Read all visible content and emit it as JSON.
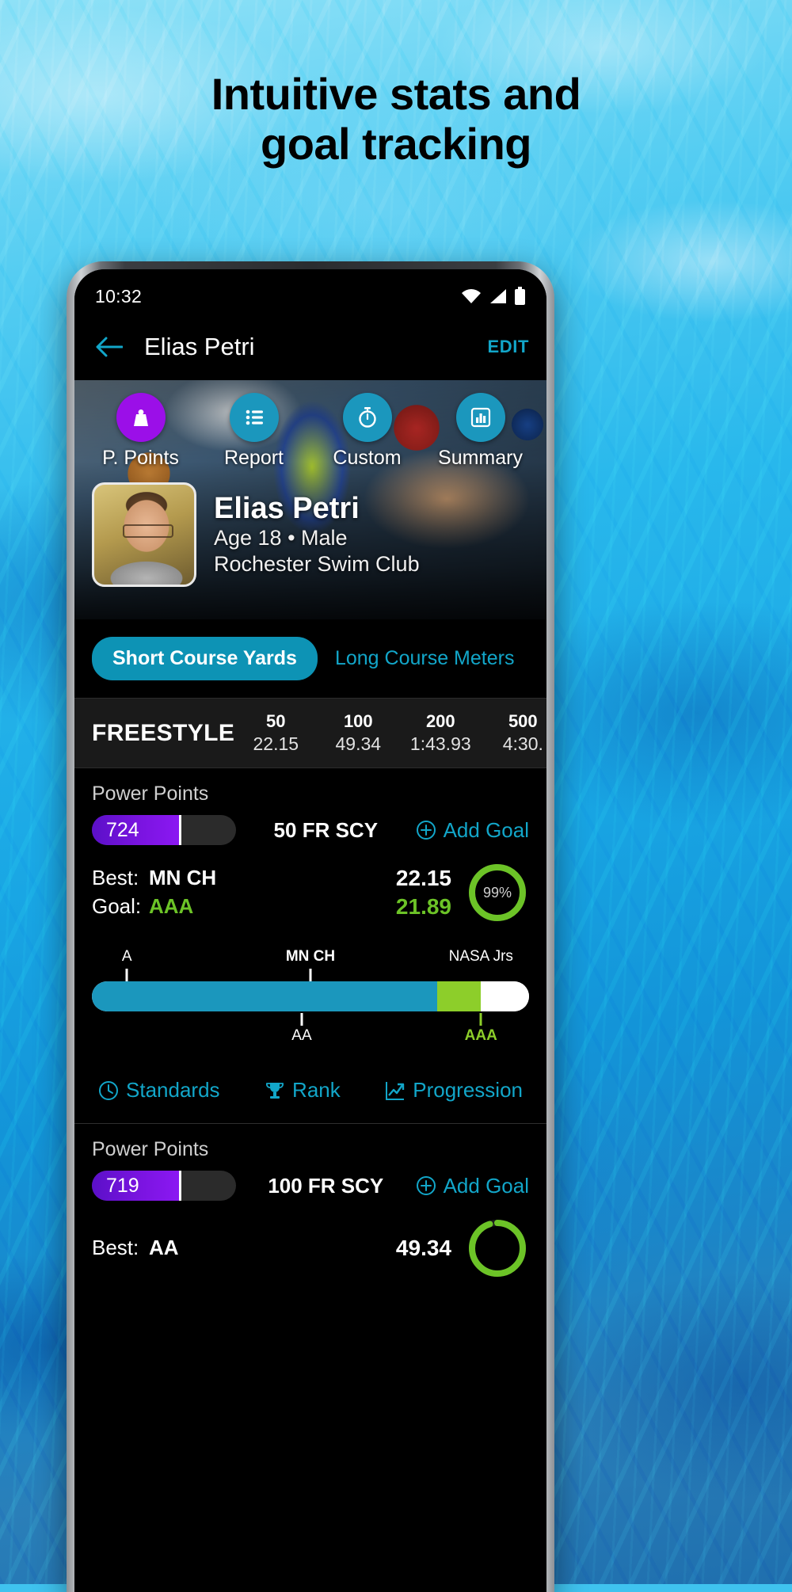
{
  "headline": {
    "line1": "Intuitive stats and",
    "line2": "goal tracking"
  },
  "status_bar": {
    "time": "10:32",
    "icons": [
      "wifi-icon",
      "signal-icon",
      "battery-icon"
    ]
  },
  "app_bar": {
    "back_icon": "back-arrow-icon",
    "title": "Elias Petri",
    "edit_label": "EDIT"
  },
  "quick_actions": [
    {
      "label": "P. Points",
      "icon": "weight-icon",
      "color": "#9b0fe8"
    },
    {
      "label": "Report",
      "icon": "list-icon",
      "color": "#1b97bd"
    },
    {
      "label": "Custom",
      "icon": "stopwatch-icon",
      "color": "#1b97bd"
    },
    {
      "label": "Summary",
      "icon": "bar-chart-icon",
      "color": "#1b97bd"
    }
  ],
  "profile": {
    "name": "Elias Petri",
    "meta_line1": "Age 18 • Male",
    "meta_line2": "Rochester Swim Club",
    "avatar": "profile-photo"
  },
  "course_toggle": {
    "selected": "Short Course Yards",
    "other": "Long Course Meters"
  },
  "stroke_table": {
    "stroke": "FREESTYLE",
    "columns": [
      "50",
      "100",
      "200",
      "500"
    ],
    "times": [
      "22.15",
      "49.34",
      "1:43.93",
      "4:30."
    ]
  },
  "events": [
    {
      "power_points_label": "Power Points",
      "power_points_value": "724",
      "power_points_pct": 62,
      "event": "50 FR SCY",
      "add_goal_label": "Add Goal",
      "add_goal_icon": "plus-circle-icon",
      "best_key": "Best:",
      "best_value": "MN CH",
      "best_time": "22.15",
      "goal_key": "Goal:",
      "goal_value": "AAA",
      "goal_time": "21.89",
      "ring_pct": "99%",
      "ring_value": 99,
      "standards": {
        "top_labels": [
          {
            "text": "A",
            "pos": 8
          },
          {
            "text": "MN CH",
            "pos": 50
          },
          {
            "text": "NASA Jrs",
            "pos": 94
          }
        ],
        "bottom_labels": [
          {
            "text": "AA",
            "pos": 48
          },
          {
            "text": "AAA",
            "pos": 89
          }
        ],
        "segments": [
          {
            "color": "#1b97bd",
            "start": 0,
            "end": 79
          },
          {
            "color": "#8dce2a",
            "start": 79,
            "end": 89
          },
          {
            "color": "#ffffff",
            "start": 89,
            "end": 100
          }
        ]
      },
      "actions": [
        {
          "label": "Standards",
          "icon": "clock-icon"
        },
        {
          "label": "Rank",
          "icon": "trophy-icon"
        },
        {
          "label": "Progression",
          "icon": "trend-up-icon"
        }
      ]
    },
    {
      "power_points_label": "Power Points",
      "power_points_value": "719",
      "power_points_pct": 62,
      "event": "100 FR SCY",
      "add_goal_label": "Add Goal",
      "add_goal_icon": "plus-circle-icon",
      "best_key": "Best:",
      "best_value": "AA",
      "best_time": "49.34",
      "goal_key": "",
      "goal_value": "",
      "goal_time": "",
      "ring_pct": "",
      "ring_value": 95
    }
  ],
  "colors": {
    "accent_teal": "#12a6c9",
    "pill_teal": "#0d93b5",
    "purple": "#8b18f2",
    "green": "#6cc327",
    "bar_green": "#8dce2a"
  }
}
